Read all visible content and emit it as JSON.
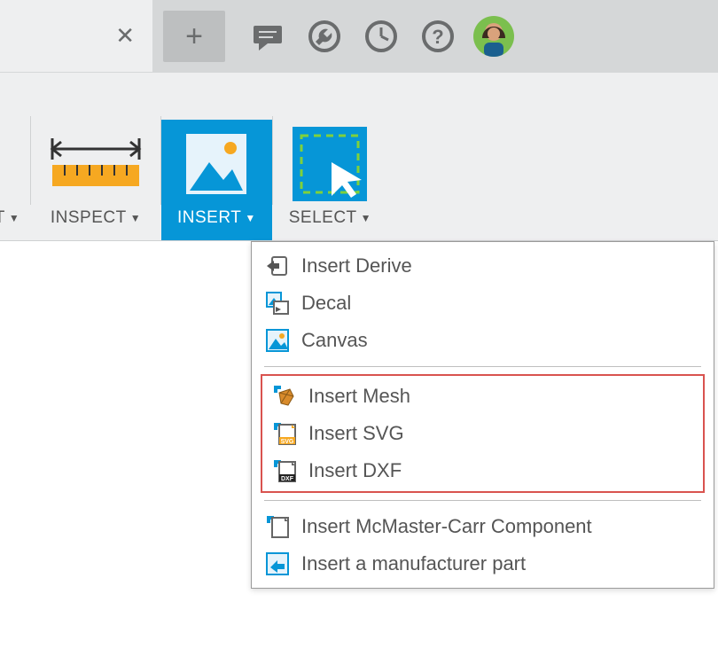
{
  "toolbar": {
    "partial_label": "T",
    "inspect_label": "INSPECT",
    "insert_label": "INSERT",
    "select_label": "SELECT"
  },
  "insert_menu": {
    "derive": "Insert Derive",
    "decal": "Decal",
    "canvas": "Canvas",
    "mesh": "Insert Mesh",
    "svg": "Insert SVG",
    "dxf": "Insert DXF",
    "mcmaster": "Insert McMaster-Carr Component",
    "mfr": "Insert a manufacturer part"
  }
}
